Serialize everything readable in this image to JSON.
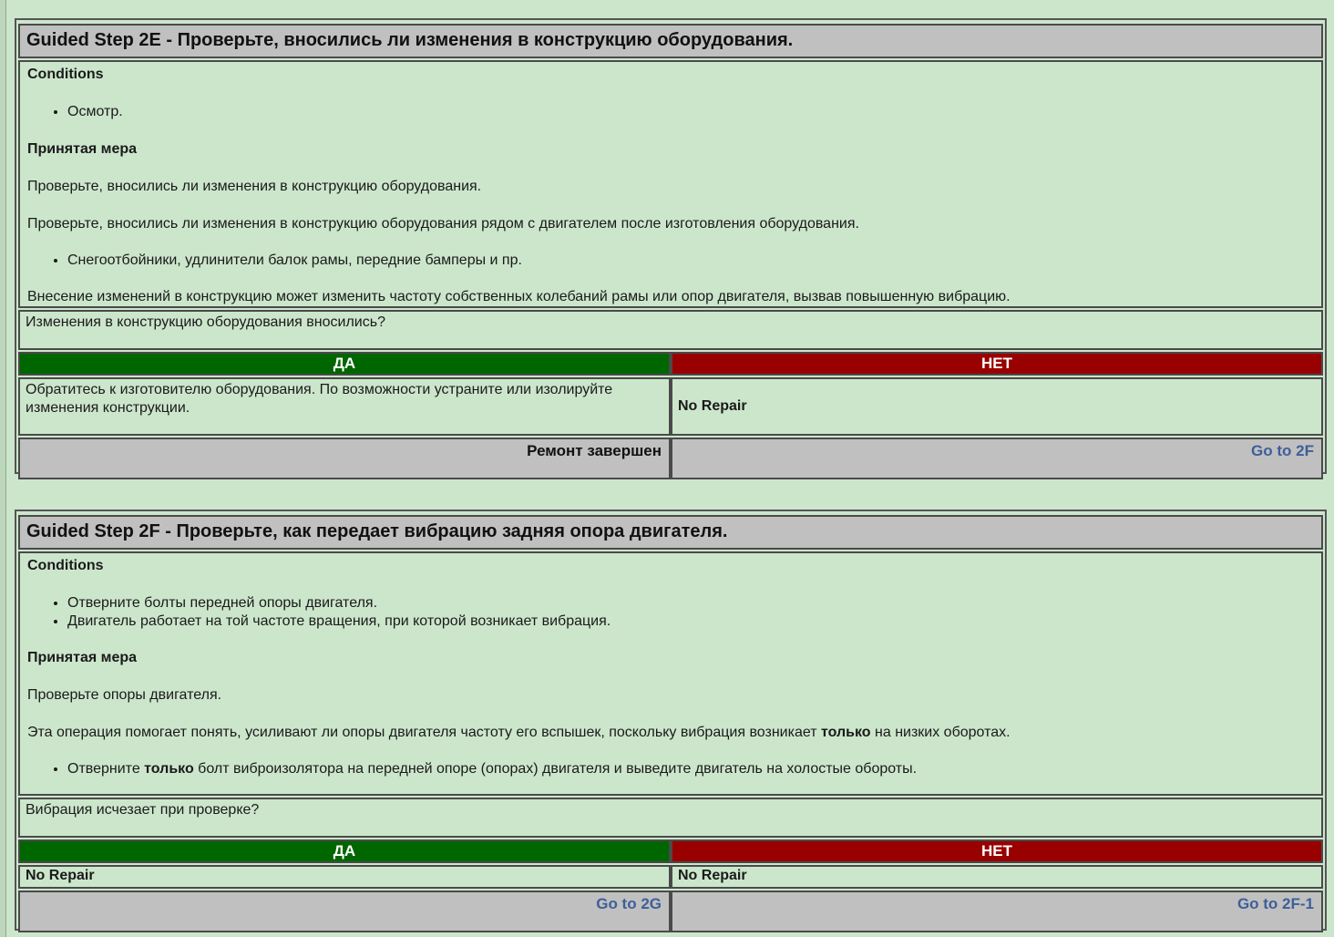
{
  "step_2e": {
    "title": "Guided Step 2E - Проверьте, вносились ли изменения в конструкцию оборудования.",
    "conditions_label": "Conditions",
    "conditions": [
      "Осмотр."
    ],
    "action_label": "Принятая мера",
    "paragraph_1": "Проверьте, вносились ли изменения в конструкцию оборудования.",
    "paragraph_2": "Проверьте, вносились ли изменения в конструкцию оборудования рядом с двигателем после изготовления оборудования.",
    "bullets": [
      "Снегоотбойники, удлинители балок рамы, передние бамперы и пр."
    ],
    "paragraph_3": "Внесение изменений в конструкцию может изменить частоту собственных колебаний рамы или опор двигателя, вызвав повышенную вибрацию.",
    "question": "Изменения в конструкцию оборудования вносились?",
    "yes_label": "ДА",
    "no_label": "НЕТ",
    "yes_result": "Обратитесь к изготовителю оборудования. По возможности устраните или изолируйте изменения конструкции.",
    "no_result": "No Repair",
    "yes_footer": "Ремонт завершен",
    "no_footer": "Go to 2F"
  },
  "step_2f": {
    "title": "Guided Step 2F - Проверьте, как передает вибрацию задняя опора двигателя.",
    "conditions_label": "Conditions",
    "conditions": [
      "Отверните болты передней опоры двигателя.",
      "Двигатель работает на той частоте вращения, при которой возникает вибрация."
    ],
    "action_label": "Принятая мера",
    "paragraph_1": "Проверьте опоры двигателя.",
    "paragraph_2_before": "Эта операция помогает понять, усиливают ли опоры двигателя частоту его вспышек, поскольку вибрация возникает ",
    "paragraph_2_bold": "только",
    "paragraph_2_after": " на низких оборотах.",
    "bullet_before": "Отверните ",
    "bullet_bold": "только",
    "bullet_after": " болт виброизолятора на передней опоре (опорах) двигателя и выведите двигатель на холостые обороты.",
    "question": "Вибрация исчезает при проверке?",
    "yes_label": "ДА",
    "no_label": "НЕТ",
    "yes_result": "No Repair",
    "no_result": "No Repair",
    "yes_footer": "Go to 2G",
    "no_footer": "Go to 2F-1"
  },
  "colors": {
    "background": "#cce6cc",
    "header_gray": "#c0c0c0",
    "yes_green": "#006600",
    "no_red": "#990000",
    "link_blue": "#3d5f9a"
  }
}
